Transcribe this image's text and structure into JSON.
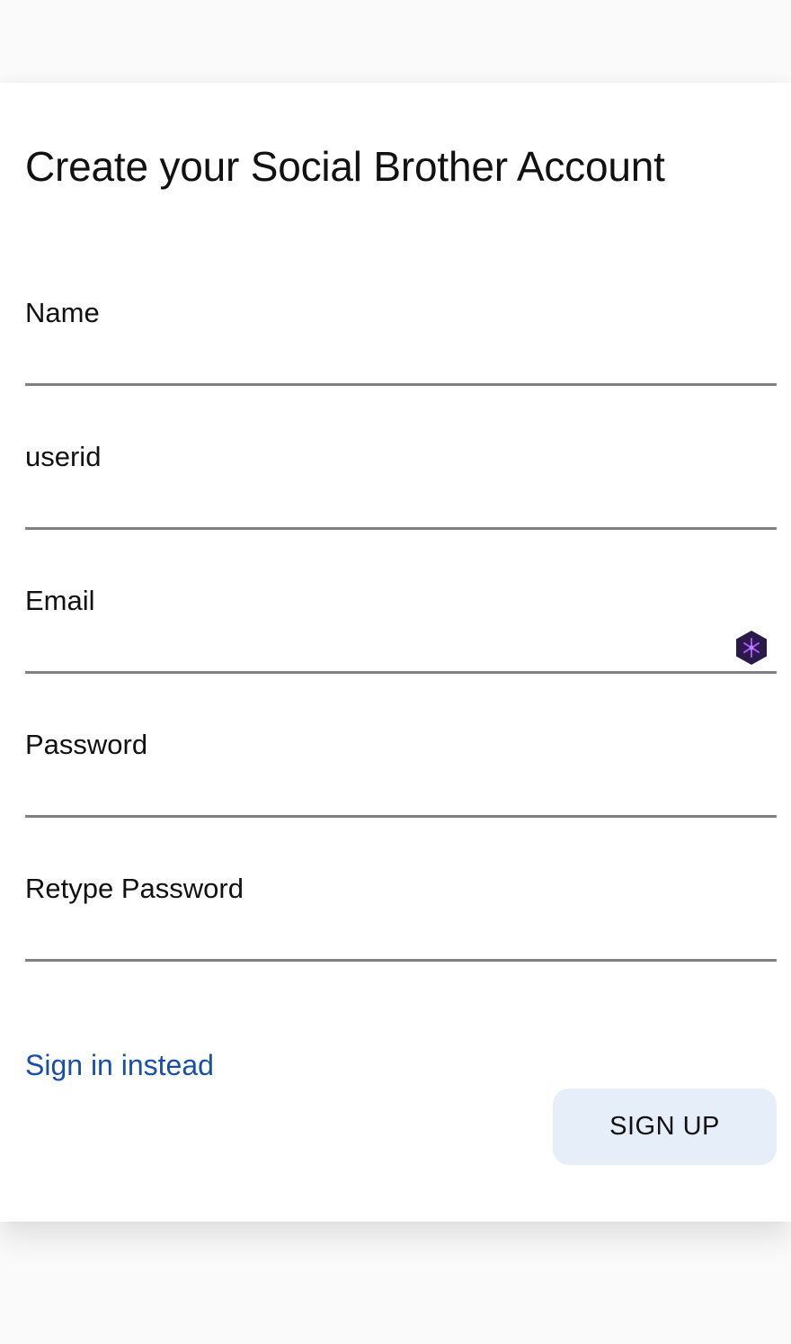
{
  "page": {
    "title": "Create your Social Brother Account"
  },
  "form": {
    "fields": [
      {
        "label": "Name",
        "value": ""
      },
      {
        "label": "userid",
        "value": ""
      },
      {
        "label": "Email",
        "value": ""
      },
      {
        "label": "Password",
        "value": ""
      },
      {
        "label": "Retype Password",
        "value": ""
      }
    ],
    "email_extension_icon": "password-manager-extension-icon"
  },
  "actions": {
    "signin_link": "Sign in instead",
    "signup_button": "SIGN UP"
  },
  "colors": {
    "link": "#1a4fa8",
    "button_bg": "#e6eefa",
    "underline": "#808080",
    "extension_icon_bg": "#2a1a4a",
    "extension_icon_accent": "#a855f7"
  }
}
